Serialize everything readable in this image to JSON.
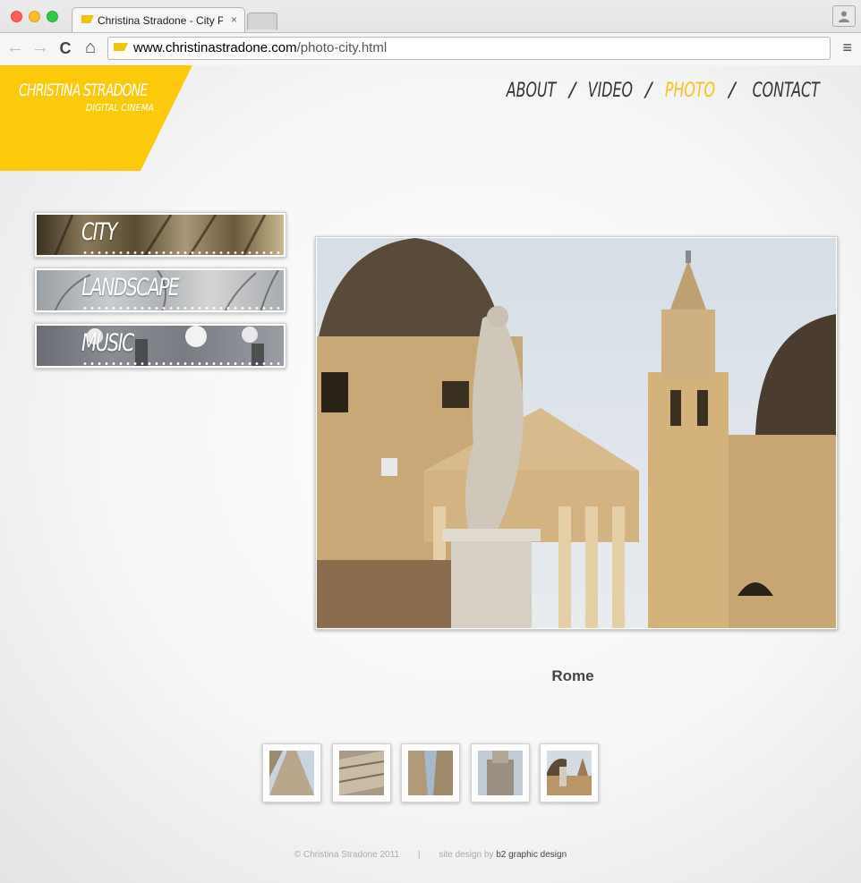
{
  "browser": {
    "tab_title": "Christina Stradone - City Photo",
    "tab_close": "×",
    "url_domain": "www.christinastradone.com",
    "url_path": "/photo-city.html",
    "back_icon": "←",
    "forward_icon": "→",
    "reload_icon": "C",
    "home_icon": "⌂",
    "menu_icon": "≡"
  },
  "site": {
    "logo_name": "CHRISTINA STRADONE",
    "logo_sub": "DIGITAL CINEMA",
    "nav": [
      {
        "label": "ABOUT",
        "active": false
      },
      {
        "label": "VIDEO",
        "active": false
      },
      {
        "label": "PHOTO",
        "active": true
      },
      {
        "label": "CONTACT",
        "active": false
      }
    ],
    "nav_separator": "/",
    "accent_color": "#fcc90b"
  },
  "categories": [
    {
      "label": "CITY"
    },
    {
      "label": "LANDSCAPE"
    },
    {
      "label": "MUSIC"
    }
  ],
  "gallery": {
    "caption": "Rome",
    "thumbnail_count": 5
  },
  "footer": {
    "copyright": "© Christina Stradone 2011",
    "separator": "|",
    "credit_prefix": "site design by ",
    "credit_link": "b2 graphic design"
  }
}
